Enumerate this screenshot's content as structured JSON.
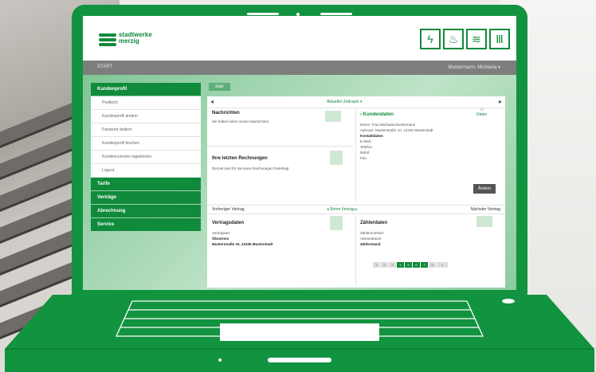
{
  "brand": {
    "line1": "stadtwerke",
    "line2": "merzig"
  },
  "header_icons": [
    "power-icon",
    "gas-flame-icon",
    "heat-waves-icon",
    "radiator-icon"
  ],
  "header_icon_glyphs": [
    "ϟ",
    "♨",
    "≋",
    "Ⅲ"
  ],
  "topnav": {
    "left": "START",
    "right": "Mustermann, Michaela ▾"
  },
  "breadcrumb": "Start",
  "sidebar": {
    "sections": [
      {
        "label": "Kundenprofil",
        "items": [
          "Postkorb",
          "Kundenprofil ändern",
          "Passwort ändern",
          "Kundenprofil löschen",
          "Kundennummer registrieren",
          "Logout"
        ]
      },
      {
        "label": "Tarife",
        "items": []
      },
      {
        "label": "Verträge",
        "items": []
      },
      {
        "label": "Abrechnung",
        "items": []
      },
      {
        "label": "Service",
        "items": []
      }
    ]
  },
  "main": {
    "date_label": "Aktueller Zeitraum ▾",
    "news": {
      "title": "Nachrichten",
      "text": "Sie haben keine neuen Nachrichten."
    },
    "bills": {
      "title": "Ihre letzten Rechnungen",
      "text": "Derzeit sind für Sie keine Rechnungen hinterlegt."
    },
    "customer": {
      "title": "› Kundendaten",
      "icon_label": "Daten",
      "lines": [
        "Name: Frau Michaela Mustermann",
        "Adresse: Musterstraße 10, 12345 Musterstadt",
        "Kontaktdaten",
        "E-Mail:",
        "Telefon:",
        "Mobil:",
        "Fax:"
      ],
      "button": "Ändern"
    },
    "contract_tabs": {
      "prev": "Vorheriger Vertrag",
      "current": "◂ Strom Vertrag ▸",
      "next": "Nächster Vertrag"
    },
    "contract": {
      "title": "Vertragsdaten",
      "lines": [
        "Vertragsart:",
        "Ökostrom",
        "Musterstraße 10, 12345 Musterstadt"
      ]
    },
    "meter": {
      "title": "Zählerdaten",
      "rows": [
        [
          "Zählernummer:",
          ""
        ],
        [
          "Ablesedatum:",
          ""
        ]
      ],
      "status": "Zählerstand"
    },
    "pager": [
      "1",
      "2",
      "3",
      "4",
      "5",
      "6",
      "7",
      "8",
      "»"
    ]
  }
}
